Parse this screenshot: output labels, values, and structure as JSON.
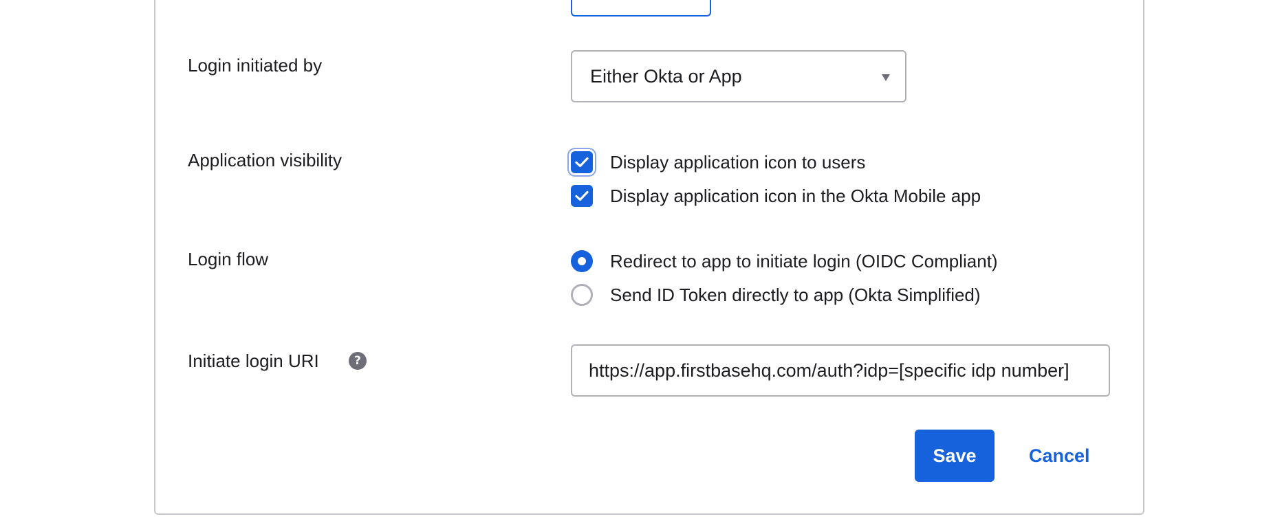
{
  "fields": {
    "login_initiated_by": {
      "label": "Login initiated by",
      "selected": "Either Okta or App"
    },
    "application_visibility": {
      "label": "Application visibility",
      "options": [
        {
          "label": "Display application icon to users",
          "checked": true
        },
        {
          "label": "Display application icon in the Okta Mobile app",
          "checked": true
        }
      ]
    },
    "login_flow": {
      "label": "Login flow",
      "options": [
        {
          "label": "Redirect to app to initiate login (OIDC Compliant)",
          "selected": true
        },
        {
          "label": "Send ID Token directly to app (Okta Simplified)",
          "selected": false
        }
      ]
    },
    "initiate_login_uri": {
      "label": "Initiate login URI",
      "help_icon": "?",
      "value": "https://app.firstbasehq.com/auth?idp=[specific idp number]"
    }
  },
  "actions": {
    "save_label": "Save",
    "cancel_label": "Cancel"
  },
  "colors": {
    "accent": "#1662dd",
    "border": "#b0b0b5",
    "text": "#1d1d21"
  }
}
